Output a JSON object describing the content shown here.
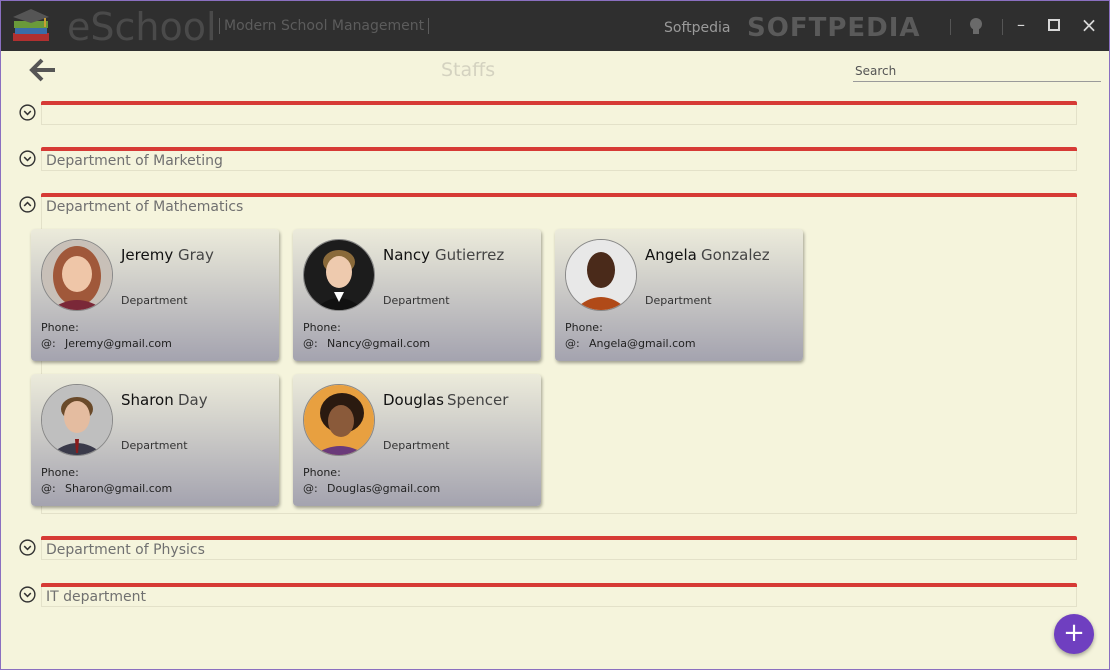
{
  "titlebar": {
    "app_name": "eSchool",
    "tagline": "Modern School Management",
    "softpedia_link": "Softpedia",
    "watermark": "SOFTPEDIA"
  },
  "header": {
    "title": "Staffs",
    "search_placeholder": "Search"
  },
  "sections": [
    {
      "title": "",
      "expanded": false
    },
    {
      "title": "Department of Marketing",
      "expanded": false
    },
    {
      "title": "Department of Mathematics",
      "expanded": true
    },
    {
      "title": "Department of Physics",
      "expanded": false
    },
    {
      "title": "IT department",
      "expanded": false
    }
  ],
  "staff": [
    {
      "first": "Jeremy",
      "last": "Gray",
      "department": "Department",
      "phone_label": "Phone:",
      "email_label": "@:",
      "email": "Jeremy@gmail.com"
    },
    {
      "first": "Nancy",
      "last": "Gutierrez",
      "department": "Department",
      "phone_label": "Phone:",
      "email_label": "@:",
      "email": "Nancy@gmail.com"
    },
    {
      "first": "Angela",
      "last": "Gonzalez",
      "department": "Department",
      "phone_label": "Phone:",
      "email_label": "@:",
      "email": "Angela@gmail.com"
    },
    {
      "first": "Sharon",
      "last": "Day",
      "department": "Department",
      "phone_label": "Phone:",
      "email_label": "@:",
      "email": "Sharon@gmail.com"
    },
    {
      "first": "Douglas",
      "last": "Spencer",
      "department": "Department",
      "phone_label": "Phone:",
      "email_label": "@:",
      "email": "Douglas@gmail.com"
    }
  ],
  "fab": {
    "label": "+"
  },
  "colors": {
    "accent_bar": "#d63a35",
    "fab": "#6f3fc0",
    "titlebar": "#2f2f2f",
    "background": "#f5f4dc"
  }
}
